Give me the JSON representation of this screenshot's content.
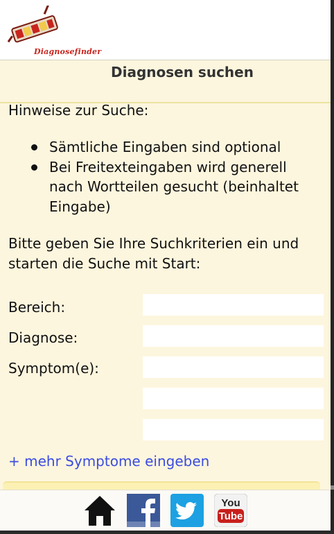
{
  "app": {
    "logo_text": "Diagnosefinder",
    "title": "Diagnosen suchen"
  },
  "hints": {
    "heading": "Hinweise zur Suche:",
    "items": [
      "Sämtliche Eingaben sind optional",
      "Bei Freitexteingaben wird generell nach Wortteilen gesucht (beinhaltet Eingabe)"
    ]
  },
  "instructions": "Bitte geben Sie Ihre Suchkriterien ein und starten die Suche mit Start:",
  "form": {
    "bereich_label": "Bereich:",
    "diagnose_label": "Diagnose:",
    "symptom_label": "Symptom(e):",
    "bereich_value": "",
    "diagnose_value": "",
    "symptom1_value": "",
    "symptom2_value": "",
    "symptom3_value": ""
  },
  "more_symptoms_link": "+ mehr Symptome eingeben",
  "footer": {
    "icons": [
      "home-icon",
      "facebook-icon",
      "twitter-icon",
      "youtube-icon"
    ],
    "youtube_top": "You",
    "youtube_bottom": "Tube"
  },
  "colors": {
    "background": "#fdf6de",
    "link": "#3b4ce0",
    "logo_red": "#c8251e",
    "facebook": "#3b5998",
    "twitter": "#1da1e2",
    "youtube_red": "#c8201c"
  }
}
